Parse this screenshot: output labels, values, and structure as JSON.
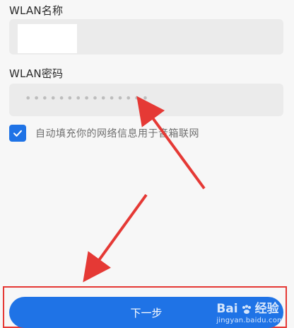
{
  "form": {
    "ssid_label": "WLAN名称",
    "password_label": "WLAN密码",
    "password_masked": "•••••••••••••••",
    "autofill_text": "自动填充你的网络信息用于音箱联网",
    "next_button": "下一步"
  },
  "watermark": {
    "brand_left": "Bai",
    "brand_right": "经验",
    "site": "jingyan.baidu.com"
  },
  "colors": {
    "accent_blue": "#1f73e6",
    "annotation_red": "#e53935"
  }
}
